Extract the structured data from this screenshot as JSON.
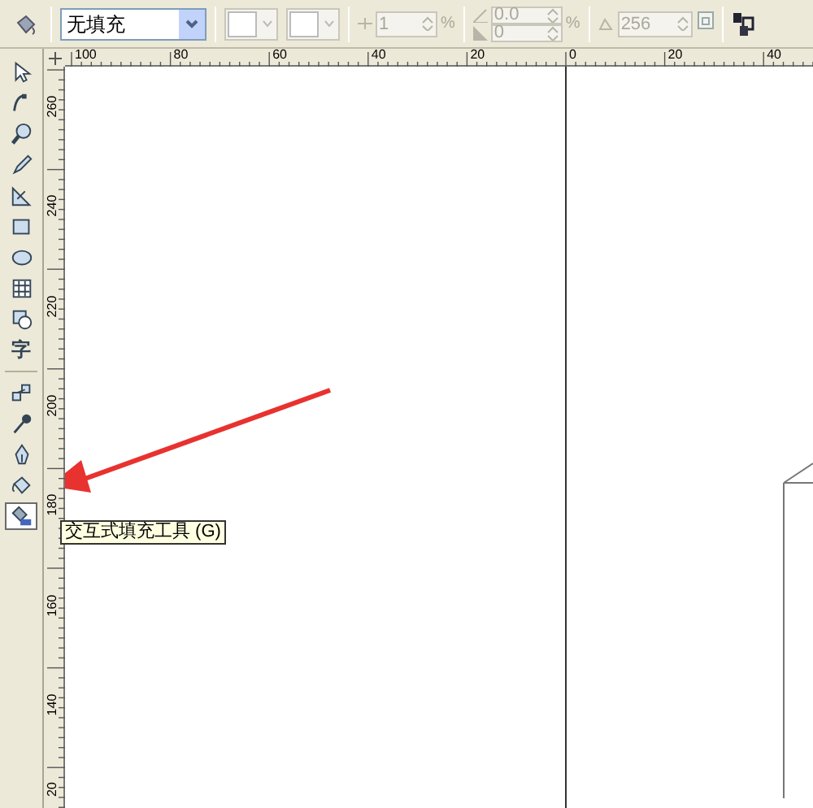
{
  "property_bar": {
    "fill_type": {
      "value": "无填充"
    },
    "midpoint": {
      "value": "1",
      "unit": "%",
      "disabled": true
    },
    "angle": {
      "value": "0.0",
      "disabled": true
    },
    "edge_pad": {
      "value": "0",
      "unit": "%",
      "disabled": true
    },
    "steps": {
      "value": "256",
      "disabled": true
    }
  },
  "toolbox": [
    {
      "kind": "pick",
      "selected": false
    },
    {
      "kind": "shape",
      "selected": false
    },
    {
      "kind": "zoom",
      "selected": false
    },
    {
      "kind": "freehand",
      "selected": false
    },
    {
      "kind": "dimension",
      "selected": false
    },
    {
      "kind": "rectangle",
      "selected": false
    },
    {
      "kind": "ellipse",
      "selected": false
    },
    {
      "kind": "table",
      "selected": false
    },
    {
      "kind": "basic_shapes",
      "selected": false
    },
    {
      "kind": "text",
      "glyph": "字",
      "selected": false
    },
    {
      "kind": "blend",
      "selected": false
    },
    {
      "kind": "eyedropper",
      "selected": false
    },
    {
      "kind": "outline",
      "selected": false
    },
    {
      "kind": "fill",
      "selected": false
    },
    {
      "kind": "interactive_fill",
      "selected": true
    }
  ],
  "horizontal_ruler": {
    "labels": [
      "100",
      "80",
      "60",
      "40",
      "20",
      "0",
      "20",
      "40"
    ]
  },
  "vertical_ruler": {
    "labels": [
      "260",
      "240",
      "220",
      "200",
      "180",
      "160",
      "140",
      "20"
    ]
  },
  "tooltip": {
    "text": "交互式填充工具 (G)"
  }
}
